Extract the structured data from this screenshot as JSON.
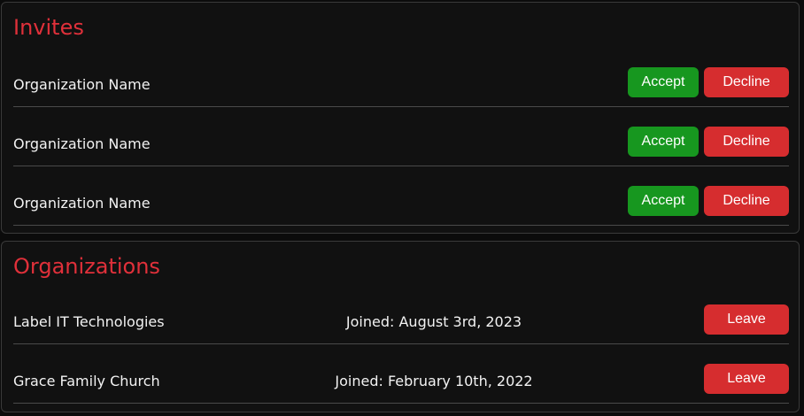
{
  "invites": {
    "title": "Invites",
    "accept_label": "Accept",
    "decline_label": "Decline",
    "items": [
      {
        "name": "Organization Name"
      },
      {
        "name": "Organization Name"
      },
      {
        "name": "Organization Name"
      }
    ]
  },
  "organizations": {
    "title": "Organizations",
    "leave_label": "Leave",
    "items": [
      {
        "name": "Label IT Technologies",
        "joined": "Joined: August 3rd, 2023"
      },
      {
        "name": "Grace Family Church",
        "joined": "Joined: February 10th, 2022"
      }
    ]
  },
  "colors": {
    "title_red": "#e0303a",
    "accept_green": "#17971f",
    "decline_red": "#d62d2f",
    "panel_bg": "#111111"
  }
}
